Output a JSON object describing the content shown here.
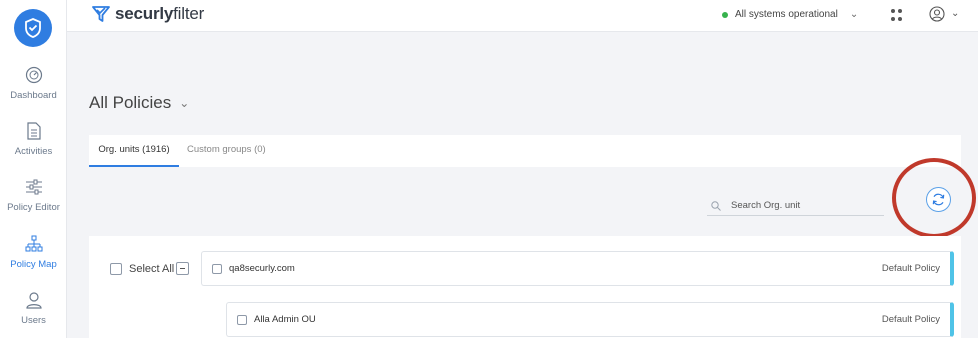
{
  "sidebar": {
    "items": [
      {
        "label": "Dashboard",
        "icon": "gauge-icon"
      },
      {
        "label": "Activities",
        "icon": "document-icon"
      },
      {
        "label": "Policy Editor",
        "icon": "sliders-icon"
      },
      {
        "label": "Policy Map",
        "icon": "org-chart-icon",
        "active": true
      },
      {
        "label": "Users",
        "icon": "user-icon"
      }
    ]
  },
  "header": {
    "brand_bold": "securly",
    "brand_rest": "filter",
    "status_text": "All systems operational"
  },
  "main": {
    "title": "All Policies",
    "tabs": [
      {
        "label": "Org. units",
        "count": "(1916)"
      },
      {
        "label": "Custom groups",
        "count": "(0)"
      }
    ],
    "search": {
      "placeholder": "Search Org. unit"
    },
    "select_all_label": "Select All",
    "rows": [
      {
        "name": "qa8securly.com",
        "policy": "Default Policy"
      },
      {
        "name": "Alla Admin OU",
        "policy": "Default Policy"
      }
    ]
  },
  "colors": {
    "accent": "#2f7de1",
    "row_accent": "#4fc3e7",
    "status_ok": "#37b24d",
    "highlight": "#c0392b"
  }
}
